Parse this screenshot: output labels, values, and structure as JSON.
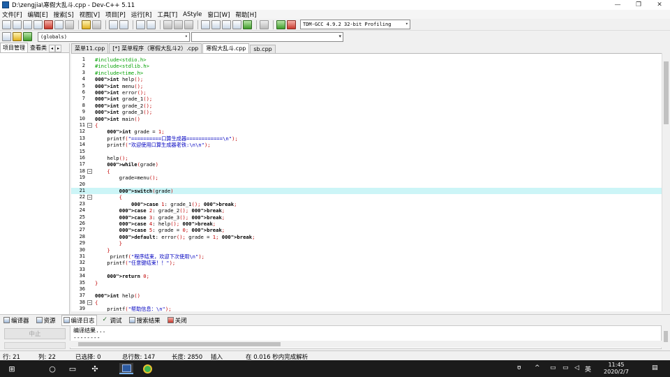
{
  "window": {
    "title": "D:\\zengjia\\寒假大乱斗.cpp - Dev-C++ 5.11",
    "min_glyph": "—",
    "max_glyph": "❐",
    "close_glyph": "✕"
  },
  "menu": [
    "文件[F]",
    "编辑[E]",
    "搜索[S]",
    "视图[V]",
    "项目[P]",
    "运行[R]",
    "工具[T]",
    "AStyle",
    "窗口[W]",
    "帮助[H]"
  ],
  "toolbar": {
    "compiler": "TDM-GCC 4.9.2 32-bit Profiling",
    "globals": "(globals)",
    "dropdown_glyph": "▾"
  },
  "left_panel": {
    "tabs": [
      "项目管理",
      "查看类"
    ],
    "arrow_left": "◂",
    "arrow_right": "▸"
  },
  "editor": {
    "tabs": [
      "菜单11.cpp",
      "[*] 菜单程序（寒假大乱斗2）.cpp",
      "寒假大乱斗.cpp",
      "sb.cpp"
    ],
    "active_tab": 2,
    "current_line": 21,
    "lines": [
      {
        "n": "1",
        "t": "#include<stdio.h>",
        "c": "pre"
      },
      {
        "n": "2",
        "t": "#include<stdlib.h>",
        "c": "pre"
      },
      {
        "n": "3",
        "t": "#include<time.h>",
        "c": "pre"
      },
      {
        "n": "4",
        "t": "int help();",
        "c": "kw"
      },
      {
        "n": "5",
        "t": "int menu();",
        "c": "kw"
      },
      {
        "n": "6",
        "t": "int error();",
        "c": "kw"
      },
      {
        "n": "7",
        "t": "int grade_1();",
        "c": "kw"
      },
      {
        "n": "8",
        "t": "int grade_2();",
        "c": "kw"
      },
      {
        "n": "9",
        "t": "int grade_3();",
        "c": "kw"
      },
      {
        "n": "10",
        "t": "int main()",
        "c": "kw"
      },
      {
        "n": "11",
        "t": "{",
        "c": "br",
        "fold": "−"
      },
      {
        "n": "12",
        "t": "    int grade = 1;",
        "c": "kw"
      },
      {
        "n": "13",
        "t": "    printf(\"==========口算生成器============\\n\");",
        "c": "str"
      },
      {
        "n": "14",
        "t": "    printf(\"欢迎使用口算生成器老铁:\\n\\n\");",
        "c": "str"
      },
      {
        "n": "15",
        "t": "",
        "c": "plain"
      },
      {
        "n": "16",
        "t": "    help();",
        "c": "plain"
      },
      {
        "n": "17",
        "t": "    while(grade)",
        "c": "kw"
      },
      {
        "n": "18",
        "t": "    {",
        "c": "br",
        "fold": "−"
      },
      {
        "n": "19",
        "t": "        grade=menu();",
        "c": "plain"
      },
      {
        "n": "20",
        "t": "",
        "c": "plain"
      },
      {
        "n": "21",
        "t": "        switch(grade)",
        "c": "kw"
      },
      {
        "n": "22",
        "t": "        {",
        "c": "br",
        "fold": "−"
      },
      {
        "n": "23",
        "t": "            case 1: grade_1(); break;",
        "c": "kw"
      },
      {
        "n": "24",
        "t": "        case 2: grade_2(); break;",
        "c": "kw"
      },
      {
        "n": "25",
        "t": "        case 3: grade_3(); break;",
        "c": "kw"
      },
      {
        "n": "26",
        "t": "        case 4: help(); break;",
        "c": "kw"
      },
      {
        "n": "27",
        "t": "        case 5: grade = 0; break;",
        "c": "kw"
      },
      {
        "n": "28",
        "t": "        default: error(); grade = 1; break;",
        "c": "kw"
      },
      {
        "n": "29",
        "t": "        }",
        "c": "br"
      },
      {
        "n": "30",
        "t": "    }",
        "c": "br"
      },
      {
        "n": "31",
        "t": "     printf(\"程序结束，欢迎下次使用\\n\");",
        "c": "str"
      },
      {
        "n": "32",
        "t": "    printf(\"任意键结束！！\");",
        "c": "str"
      },
      {
        "n": "33",
        "t": "",
        "c": "plain"
      },
      {
        "n": "34",
        "t": "    return 0;",
        "c": "kw"
      },
      {
        "n": "35",
        "t": "}",
        "c": "br"
      },
      {
        "n": "36",
        "t": "",
        "c": "plain"
      },
      {
        "n": "37",
        "t": "int help()",
        "c": "kw"
      },
      {
        "n": "38",
        "t": "{",
        "c": "br",
        "fold": "−"
      },
      {
        "n": "39",
        "t": "    printf(\"帮助信息：\\n\");",
        "c": "str"
      }
    ]
  },
  "bottom": {
    "tabs": [
      "编译器",
      "资源",
      "编译日志",
      "调试",
      "搜索结果",
      "关闭"
    ],
    "active_tab": 2,
    "abort_label": "中止",
    "output_lines": [
      "编译结果...",
      "--------"
    ]
  },
  "status": {
    "row": "行:  21",
    "col": "列:  22",
    "selected": "已选择:  0",
    "total_lines": "总行数:  147",
    "length": "长度:  2850",
    "insert": "插入",
    "parse": "在 0.016 秒内完成解析"
  },
  "taskbar": {
    "start_glyph": "⊞",
    "search_glyph": "○",
    "taskview_glyph": "▭",
    "tray_person": "ʊ",
    "tray_up": "^",
    "tray_net": "▭",
    "tray_vol": "◁",
    "ime": "英",
    "time": "11:45",
    "date": "2020/2/7",
    "notify_glyph": "▤"
  }
}
